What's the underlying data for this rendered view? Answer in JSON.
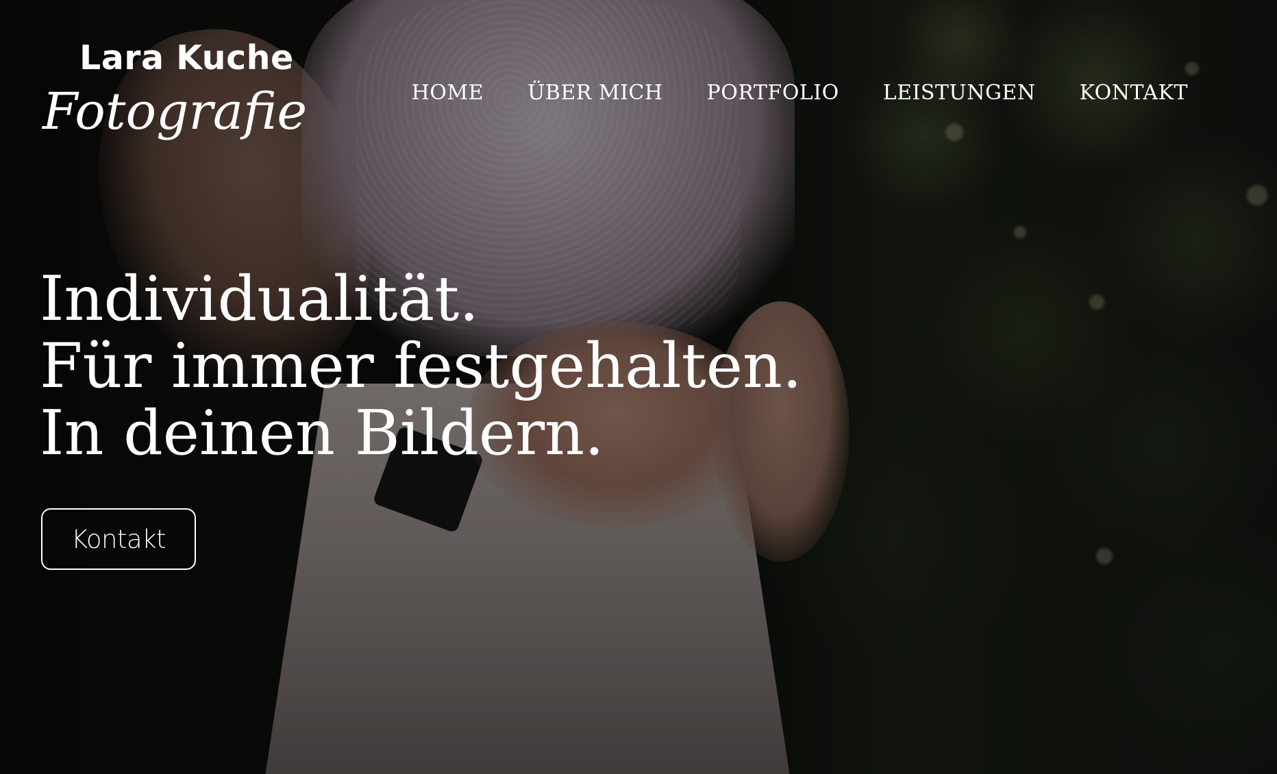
{
  "logo": {
    "name": "Lara Kuche",
    "subtitle": "Fotografie"
  },
  "nav": {
    "items": [
      {
        "label": "HOME"
      },
      {
        "label": "ÜBER MICH"
      },
      {
        "label": "PORTFOLIO"
      },
      {
        "label": "LEISTUNGEN"
      },
      {
        "label": "KONTAKT"
      }
    ]
  },
  "hero": {
    "headline_lines": [
      "Individualität.",
      "Für immer festgehalten.",
      "In deinen Bildern."
    ],
    "cta_label": "Kontakt",
    "background_image": "wedding-couple-photo"
  },
  "colors": {
    "text": "#ffffff",
    "background": "#0b0b0a"
  }
}
